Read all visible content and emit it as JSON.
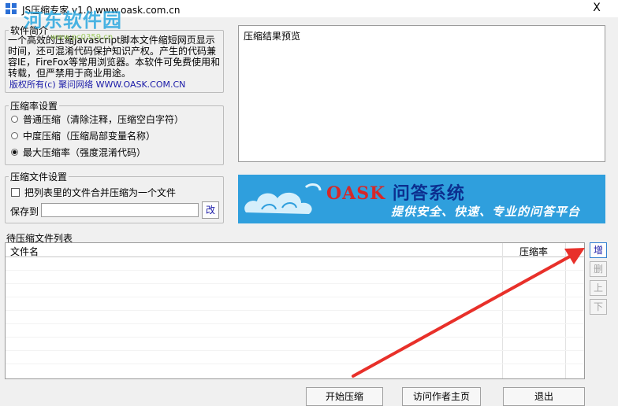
{
  "window": {
    "title": "JS压缩专家 v1.0    www.oask.com.cn",
    "close": "X"
  },
  "watermark": {
    "text": "河东软件园",
    "url": "www.pc0359.cn"
  },
  "intro": {
    "legend": "软件简介",
    "text": "一个高效的压缩Javascript脚本文件缩短网页显示时间，还可混淆代码保护知识产权。产生的代码兼容IE，FireFox等常用浏览器。本软件可免费使用和转载，但严禁用于商业用途。",
    "copyright": "版权所有(c) 聚问网络 WWW.OASK.COM.CN"
  },
  "preview": {
    "label": "压缩结果预览"
  },
  "compression": {
    "legend": "压缩率设置",
    "options": [
      {
        "label": "普通压缩（清除注释，压缩空白字符）",
        "checked": false
      },
      {
        "label": "中度压缩（压缩局部变量名称）",
        "checked": false
      },
      {
        "label": "最大压缩率（强度混淆代码）",
        "checked": true
      }
    ]
  },
  "file_settings": {
    "legend": "压缩文件设置",
    "merge_label": "把列表里的文件合并压缩为一个文件",
    "merge_checked": false,
    "save_label": "保存到",
    "save_value": "",
    "change_button": "改"
  },
  "banner": {
    "logo": "OASK",
    "title": "问答系统",
    "subtitle": "提供安全、快速、专业的问答平台"
  },
  "file_list": {
    "label": "待压缩文件列表",
    "columns": [
      "文件名",
      "压缩率"
    ],
    "rows": []
  },
  "side_buttons": [
    {
      "label": "增",
      "enabled": true
    },
    {
      "label": "删",
      "enabled": false
    },
    {
      "label": "上",
      "enabled": false
    },
    {
      "label": "下",
      "enabled": false
    }
  ],
  "bottom_buttons": {
    "start": "开始压缩",
    "visit": "访问作者主页",
    "exit": "退出"
  },
  "colors": {
    "banner_bg": "#2f9fdd",
    "annotation_arrow": "#e8302a",
    "link_blue": "#1a1aa8"
  }
}
